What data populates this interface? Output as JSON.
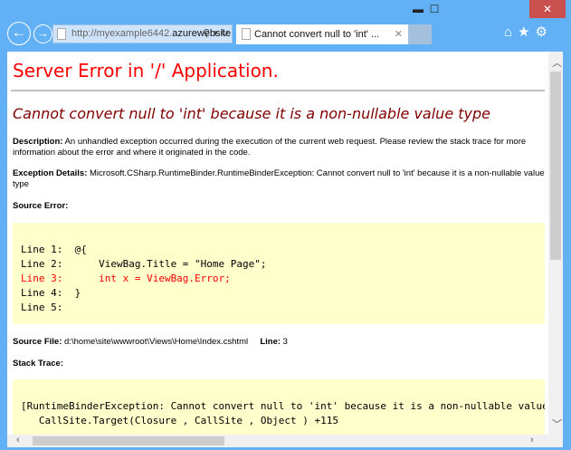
{
  "browser": {
    "url_prefix": "http://myexample6442.",
    "url_domain": "azurewebsite...",
    "tab_title": "Cannot convert null to 'int' ...",
    "minimize": "▬",
    "maximize": "☐",
    "close": "✕"
  },
  "page": {
    "title": "Server Error in '/' Application.",
    "error_heading": "Cannot convert null to 'int' because it is a non-nullable value type",
    "description_label": "Description:",
    "description": "An unhandled exception occurred during the execution of the current web request. Please review the stack trace for more information about the error and where it originated in the code.",
    "exception_label": "Exception Details:",
    "exception": "Microsoft.CSharp.RuntimeBinder.RuntimeBinderException: Cannot convert null to 'int' because it is a non-nullable value type",
    "source_error_label": "Source Error:",
    "source_lines": [
      "Line 1:  @{",
      "Line 2:      ViewBag.Title = \"Home Page\";",
      "Line 3:      int x = ViewBag.Error;",
      "Line 4:  }",
      "Line 5:"
    ],
    "source_file_label": "Source File:",
    "source_file": "d:\\home\\site\\wwwroot\\Views\\Home\\Index.cshtml",
    "line_label": "Line:",
    "line": "3",
    "stack_trace_label": "Stack Trace:",
    "stack_lines": [
      "[RuntimeBinderException: Cannot convert null to 'int' because it is a non-nullable value type]",
      "   CallSite.Target(Closure , CallSite , Object ) +115"
    ]
  }
}
